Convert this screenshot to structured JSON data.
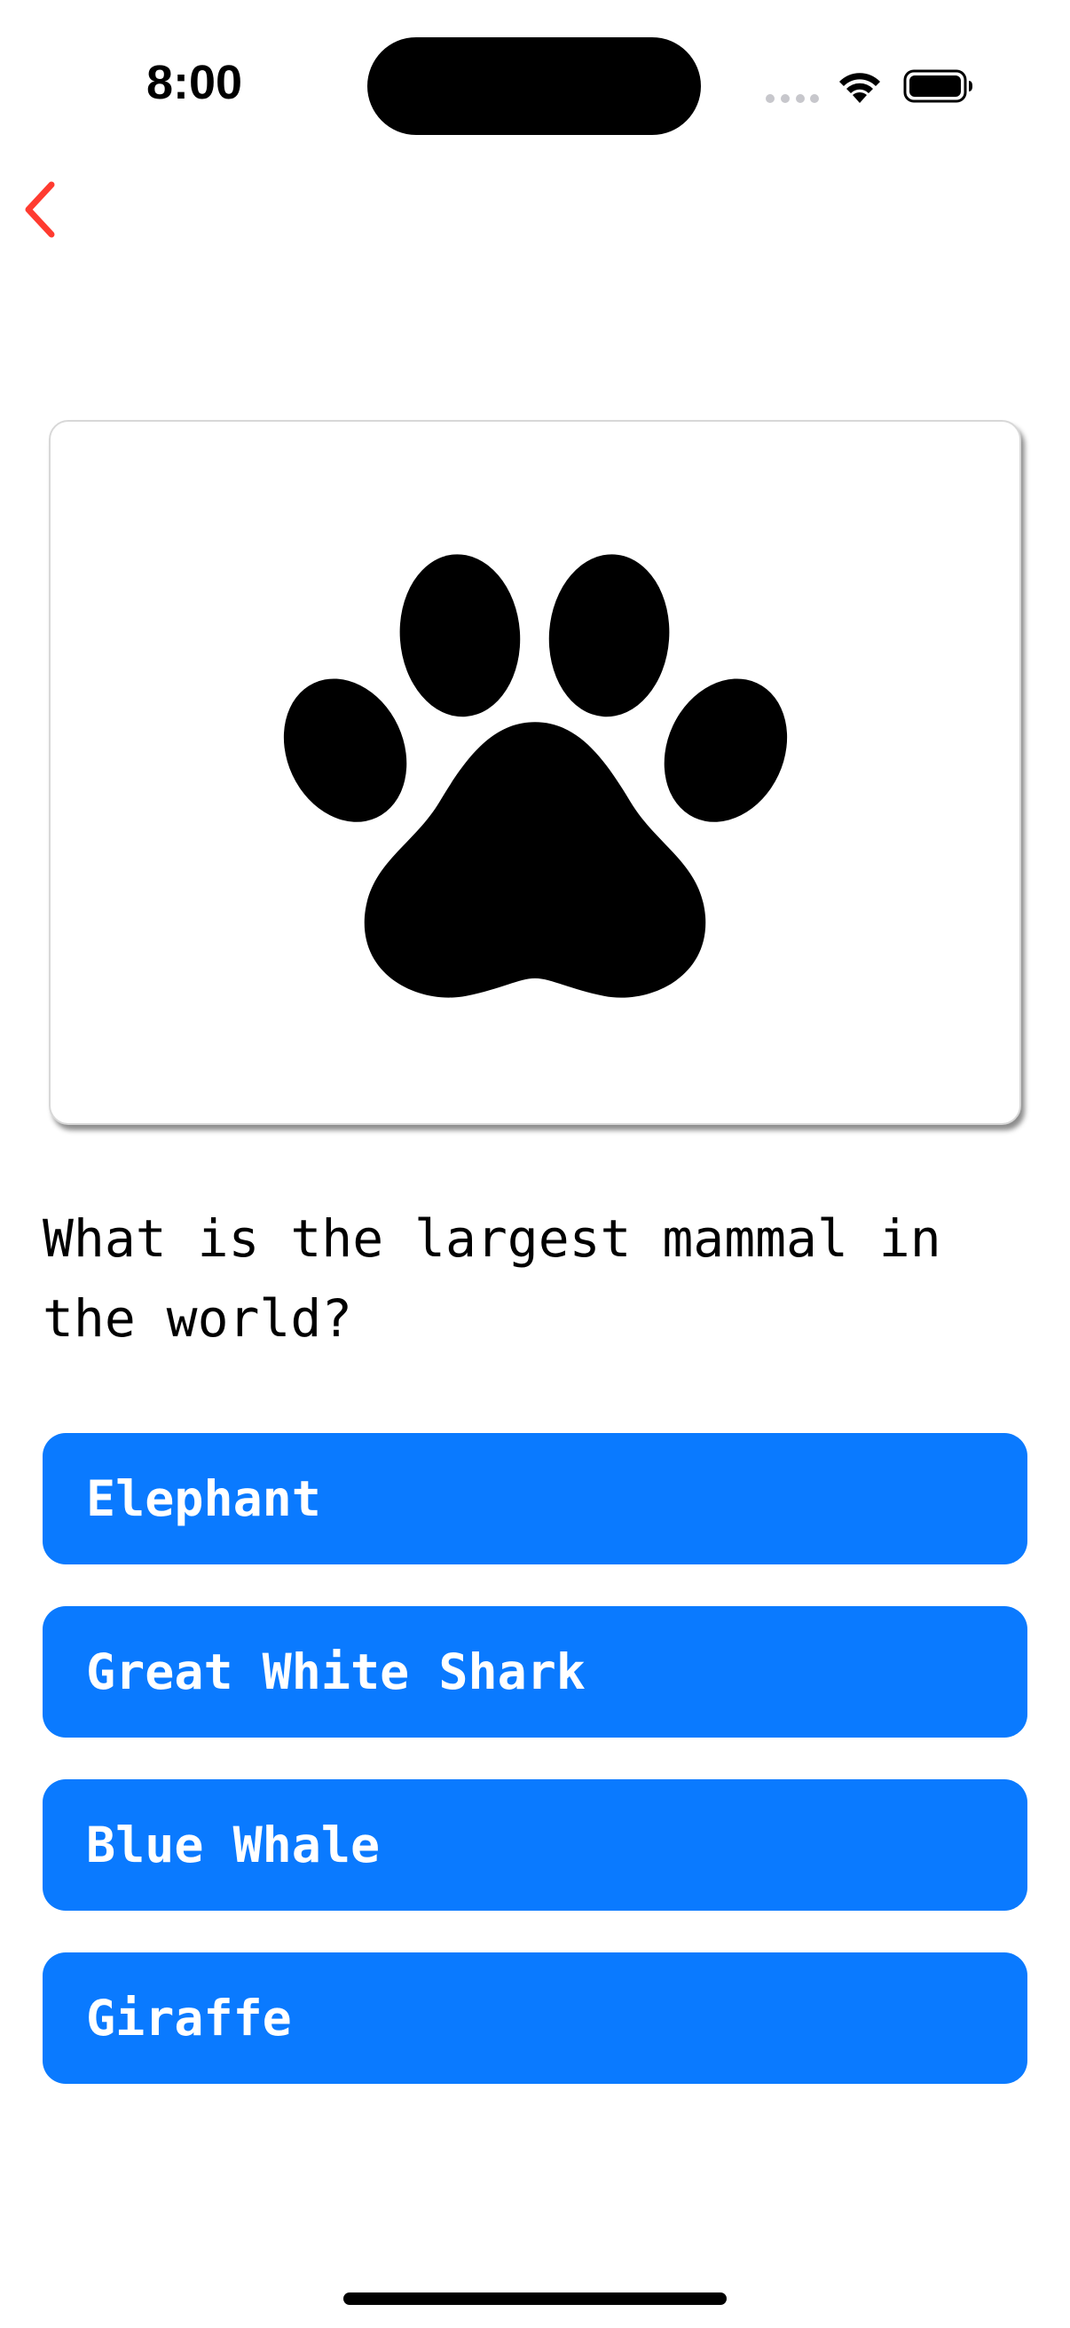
{
  "status_bar": {
    "time": "8:00"
  },
  "nav": {
    "back_icon": "chevron-left-icon",
    "accent_color": "#ff3b30"
  },
  "card": {
    "image_icon": "paw-print-icon"
  },
  "question": {
    "text": "What is the largest mammal in the world?"
  },
  "answers": [
    {
      "label": "Elephant"
    },
    {
      "label": "Great White Shark"
    },
    {
      "label": "Blue Whale"
    },
    {
      "label": "Giraffe"
    }
  ],
  "colors": {
    "button_background": "#0a7aff",
    "button_text": "#ffffff"
  }
}
